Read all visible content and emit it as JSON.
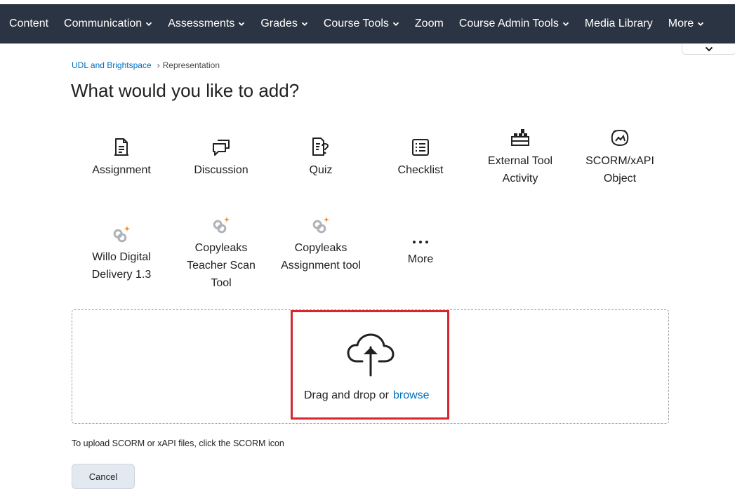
{
  "nav": {
    "items": [
      {
        "label": "Content",
        "dropdown": false
      },
      {
        "label": "Communication",
        "dropdown": true
      },
      {
        "label": "Assessments",
        "dropdown": true
      },
      {
        "label": "Grades",
        "dropdown": true
      },
      {
        "label": "Course Tools",
        "dropdown": true
      },
      {
        "label": "Zoom",
        "dropdown": false
      },
      {
        "label": "Course Admin Tools",
        "dropdown": true
      },
      {
        "label": "Media Library",
        "dropdown": false
      },
      {
        "label": "More",
        "dropdown": true
      }
    ],
    "background": "#2b3442"
  },
  "breadcrumb": {
    "parent": "UDL and Brightspace",
    "current": "Representation"
  },
  "title": "What would you like to add?",
  "tiles": [
    {
      "label": "Assignment",
      "icon": "assignment-icon"
    },
    {
      "label": "Discussion",
      "icon": "discussion-icon"
    },
    {
      "label": "Quiz",
      "icon": "quiz-icon"
    },
    {
      "label": "Checklist",
      "icon": "checklist-icon"
    },
    {
      "label": "External Tool Activity",
      "icon": "external-tool-icon"
    },
    {
      "label": "SCORM/xAPI Object",
      "icon": "scorm-icon"
    },
    {
      "label": "Willo Digital Delivery 1.3",
      "icon": "lti-link-icon"
    },
    {
      "label": "Copyleaks Teacher Scan Tool",
      "icon": "lti-link-icon"
    },
    {
      "label": "Copyleaks Assignment tool",
      "icon": "lti-link-icon"
    },
    {
      "label": "More",
      "icon": "ellipsis-icon"
    }
  ],
  "upload": {
    "drop_text": "Drag and drop or",
    "browse_label": "browse",
    "hint": "To upload SCORM or xAPI files, click the SCORM icon"
  },
  "actions": {
    "cancel_label": "Cancel"
  },
  "colors": {
    "link": "#006fbf",
    "highlight_border": "#d7262f",
    "icon_accent": "#f08a24"
  }
}
